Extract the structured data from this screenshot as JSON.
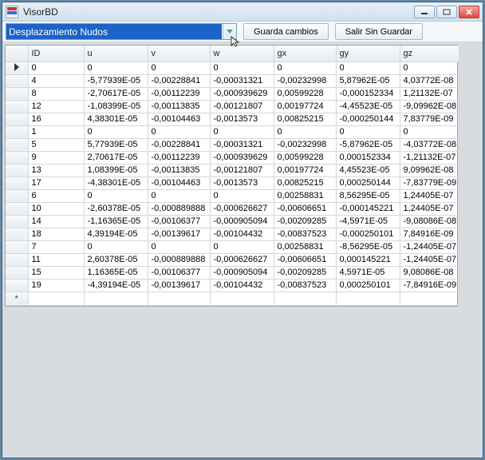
{
  "window": {
    "title": "VisorBD"
  },
  "toolbar": {
    "combo_value": "Desplazamiento Nudos",
    "btn_save": "Guarda cambios",
    "btn_exit": "Salir Sin Guardar"
  },
  "grid": {
    "headers": [
      "ID",
      "u",
      "v",
      "w",
      "gx",
      "gy",
      "gz"
    ],
    "rows": [
      {
        "ID": "0",
        "u": "0",
        "v": "0",
        "w": "0",
        "gx": "0",
        "gy": "0",
        "gz": "0"
      },
      {
        "ID": "4",
        "u": "-5,77939E-05",
        "v": "-0,00228841",
        "w": "-0,00031321",
        "gx": "-0,00232998",
        "gy": "5,87962E-05",
        "gz": "4,03772E-08"
      },
      {
        "ID": "8",
        "u": "-2,70617E-05",
        "v": "-0,00112239",
        "w": "-0,000939629",
        "gx": "0,00599228",
        "gy": "-0,000152334",
        "gz": "1,21132E-07"
      },
      {
        "ID": "12",
        "u": "-1,08399E-05",
        "v": "-0,00113835",
        "w": "-0,00121807",
        "gx": "0,00197724",
        "gy": "-4,45523E-05",
        "gz": "-9,09962E-08"
      },
      {
        "ID": "16",
        "u": "4,38301E-05",
        "v": "-0,00104463",
        "w": "-0,0013573",
        "gx": "0,00825215",
        "gy": "-0,000250144",
        "gz": "7,83779E-09"
      },
      {
        "ID": "1",
        "u": "0",
        "v": "0",
        "w": "0",
        "gx": "0",
        "gy": "0",
        "gz": "0"
      },
      {
        "ID": "5",
        "u": "5,77939E-05",
        "v": "-0,00228841",
        "w": "-0,00031321",
        "gx": "-0,00232998",
        "gy": "-5,87962E-05",
        "gz": "-4,03772E-08"
      },
      {
        "ID": "9",
        "u": "2,70617E-05",
        "v": "-0,00112239",
        "w": "-0,000939629",
        "gx": "0,00599228",
        "gy": "0,000152334",
        "gz": "-1,21132E-07"
      },
      {
        "ID": "13",
        "u": "1,08399E-05",
        "v": "-0,00113835",
        "w": "-0,00121807",
        "gx": "0,00197724",
        "gy": "4,45523E-05",
        "gz": "9,09962E-08"
      },
      {
        "ID": "17",
        "u": "-4,38301E-05",
        "v": "-0,00104463",
        "w": "-0,0013573",
        "gx": "0,00825215",
        "gy": "0,000250144",
        "gz": "-7,83779E-09"
      },
      {
        "ID": "6",
        "u": "0",
        "v": "0",
        "w": "0",
        "gx": "0,00258831",
        "gy": "8,56295E-05",
        "gz": "1,24405E-07"
      },
      {
        "ID": "10",
        "u": "-2,60378E-05",
        "v": "-0,000889888",
        "w": "-0,000626627",
        "gx": "-0,00606651",
        "gy": "-0,000145221",
        "gz": "1,24405E-07"
      },
      {
        "ID": "14",
        "u": "-1,16365E-05",
        "v": "-0,00106377",
        "w": "-0,000905094",
        "gx": "-0,00209285",
        "gy": "-4,5971E-05",
        "gz": "-9,08086E-08"
      },
      {
        "ID": "18",
        "u": "4,39194E-05",
        "v": "-0,00139617",
        "w": "-0,00104432",
        "gx": "-0,00837523",
        "gy": "-0,000250101",
        "gz": "7,84916E-09"
      },
      {
        "ID": "7",
        "u": "0",
        "v": "0",
        "w": "0",
        "gx": "0,00258831",
        "gy": "-8,56295E-05",
        "gz": "-1,24405E-07"
      },
      {
        "ID": "11",
        "u": "2,60378E-05",
        "v": "-0,000889888",
        "w": "-0,000626627",
        "gx": "-0,00606651",
        "gy": "0,000145221",
        "gz": "-1,24405E-07"
      },
      {
        "ID": "15",
        "u": "1,16365E-05",
        "v": "-0,00106377",
        "w": "-0,000905094",
        "gx": "-0,00209285",
        "gy": "4,5971E-05",
        "gz": "9,08086E-08"
      },
      {
        "ID": "19",
        "u": "-4,39194E-05",
        "v": "-0,00139617",
        "w": "-0,00104432",
        "gx": "-0,00837523",
        "gy": "0,000250101",
        "gz": "-7,84916E-09"
      }
    ]
  }
}
